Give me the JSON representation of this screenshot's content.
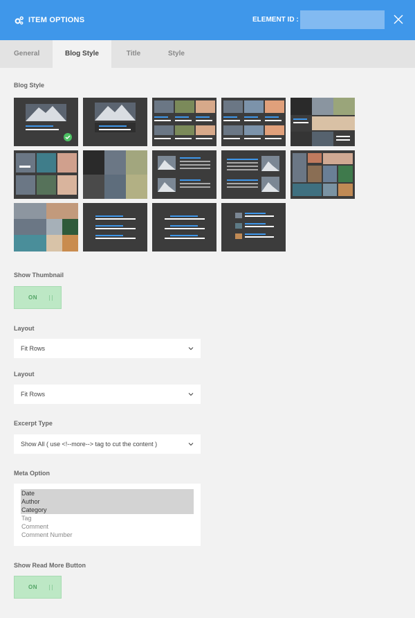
{
  "header": {
    "title": "ITEM OPTIONS",
    "element_id_label": "ELEMENT ID :",
    "element_id_value": "",
    "accent_color": "#3f97ea"
  },
  "tabs": [
    {
      "label": "General",
      "active": false
    },
    {
      "label": "Blog Style",
      "active": true
    },
    {
      "label": "Title",
      "active": false
    },
    {
      "label": "Style",
      "active": false
    }
  ],
  "blog_style": {
    "label": "Blog Style",
    "selected_index": 0,
    "thumbnails": 14
  },
  "show_thumbnail": {
    "label": "Show Thumbnail",
    "value": "ON"
  },
  "layout1": {
    "label": "Layout",
    "value": "Fit Rows"
  },
  "layout2": {
    "label": "Layout",
    "value": "Fit Rows"
  },
  "excerpt": {
    "label": "Excerpt Type",
    "value": "Show All ( use <!--more--> tag to cut the content )"
  },
  "meta": {
    "label": "Meta Option",
    "options": [
      {
        "label": "Date",
        "selected": true
      },
      {
        "label": "Author",
        "selected": true
      },
      {
        "label": "Category",
        "selected": true
      },
      {
        "label": "Tag",
        "selected": false
      },
      {
        "label": "Comment",
        "selected": false
      },
      {
        "label": "Comment Number",
        "selected": false
      }
    ]
  },
  "show_read_more": {
    "label": "Show Read More Button",
    "value": "ON"
  }
}
